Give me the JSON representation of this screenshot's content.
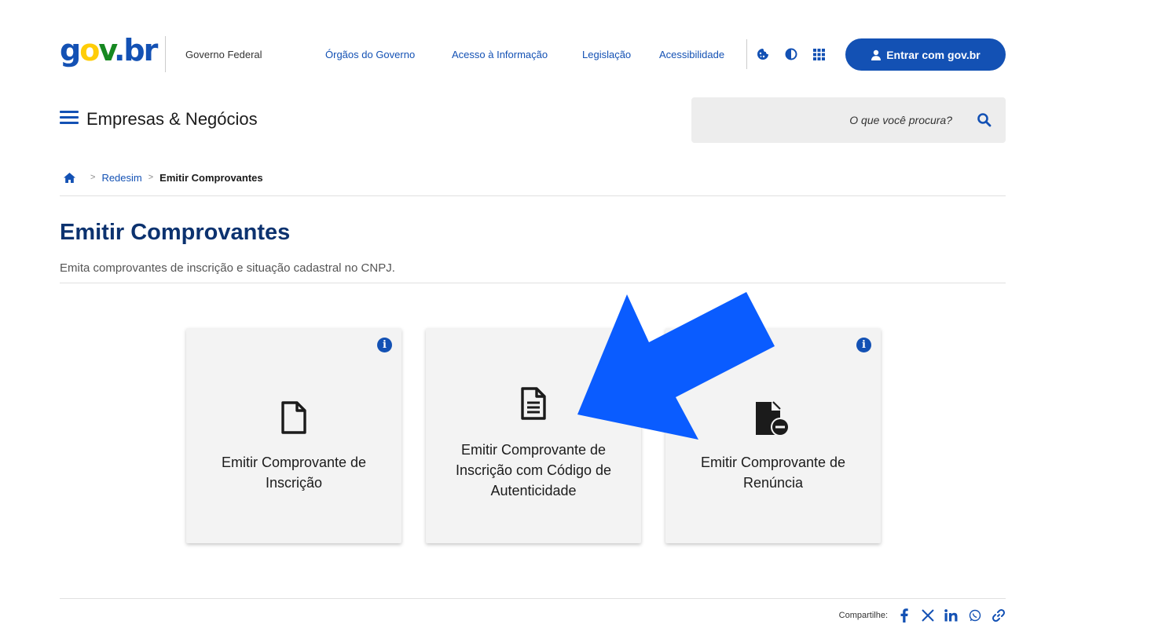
{
  "header": {
    "logo": {
      "g": "g",
      "o": "o",
      "v": "v",
      "dot": ".",
      "br": "br"
    },
    "org_label": "Governo Federal",
    "links": [
      "Órgãos do Governo",
      "Acesso à Informação",
      "Legislação",
      "Acessibilidade"
    ],
    "icons": [
      "cookie-icon",
      "contrast-icon",
      "apps-grid-icon"
    ],
    "login_label": "Entrar com gov.br"
  },
  "subheader": {
    "site_name": "Empresas & Negócios",
    "search_placeholder": "O que você procura?"
  },
  "breadcrumb": {
    "items": [
      {
        "label": "Redesim",
        "link": true
      },
      {
        "label": "Emitir Comprovantes",
        "link": false
      }
    ]
  },
  "main": {
    "title": "Emitir Comprovantes",
    "description": "Emita comprovantes de inscrição e situação cadastral no CNPJ.",
    "cards": [
      {
        "label_lines": [
          "Emitir Comprovante de",
          "Inscrição"
        ],
        "icon": "file-icon"
      },
      {
        "label_lines": [
          "Emitir Comprovante de",
          "Inscrição com Código de",
          "Autenticidade"
        ],
        "icon": "file-text-icon"
      },
      {
        "label_lines": [
          "Emitir Comprovante de",
          "Renúncia"
        ],
        "icon": "file-minus-icon"
      }
    ],
    "info_icon": "i"
  },
  "footer": {
    "share_label": "Compartilhe:",
    "share_icons": [
      "facebook-icon",
      "x-icon",
      "linkedin-icon",
      "whatsapp-icon",
      "link-icon"
    ]
  },
  "colors": {
    "primary": "#1351b4",
    "title": "#0c326f",
    "arrow": "#0a5cff",
    "card_bg": "#f3f3f3"
  }
}
